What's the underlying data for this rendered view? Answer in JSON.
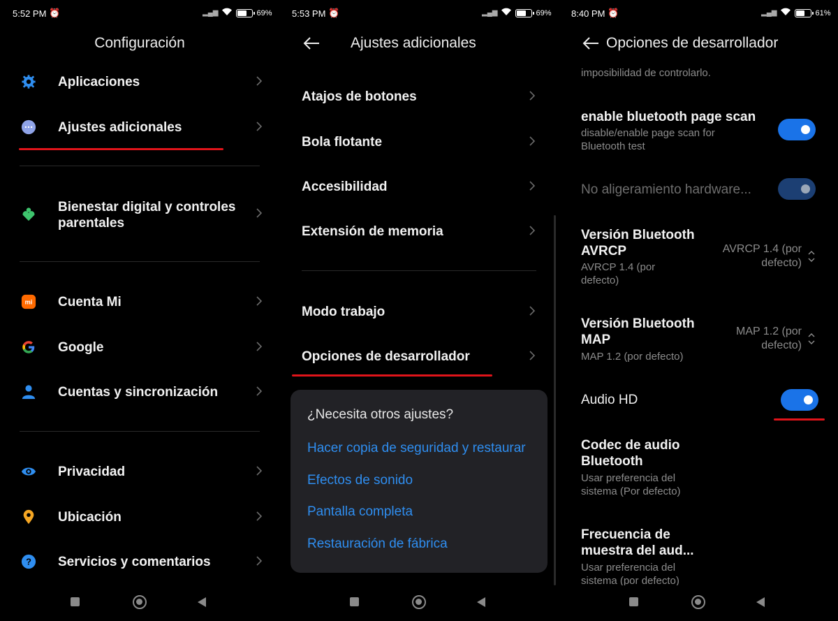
{
  "panel1": {
    "time": "5:52 PM",
    "battery": "69%",
    "battery_level": 0.69,
    "title": "Configuración",
    "items": [
      {
        "label": "Aplicaciones",
        "icon": "gear-icon"
      },
      {
        "label": "Ajustes adicionales",
        "icon": "more-dots-icon"
      },
      {
        "label": "Bienestar digital y controles parentales",
        "icon": "wellbeing-icon"
      },
      {
        "label": "Cuenta Mi",
        "icon": "mi-logo-icon"
      },
      {
        "label": "Google",
        "icon": "google-icon"
      },
      {
        "label": "Cuentas y sincronización",
        "icon": "person-icon"
      },
      {
        "label": "Privacidad",
        "icon": "eye-icon"
      },
      {
        "label": "Ubicación",
        "icon": "location-pin-icon"
      },
      {
        "label": "Servicios y comentarios",
        "icon": "help-icon"
      }
    ]
  },
  "panel2": {
    "time": "5:53 PM",
    "battery": "69%",
    "battery_level": 0.69,
    "title": "Ajustes adicionales",
    "items": [
      {
        "label": "Atajos de botones"
      },
      {
        "label": "Bola flotante"
      },
      {
        "label": "Accesibilidad"
      },
      {
        "label": "Extensión de memoria"
      },
      {
        "label": "Modo trabajo"
      },
      {
        "label": "Opciones de desarrollador"
      }
    ],
    "card": {
      "title": "¿Necesita otros ajustes?",
      "links": [
        "Hacer copia de seguridad y restaurar",
        "Efectos de sonido",
        "Pantalla completa",
        "Restauración de fábrica"
      ]
    }
  },
  "panel3": {
    "time": "8:40 PM",
    "battery": "61%",
    "battery_level": 0.61,
    "title": "Opciones de desarrollador",
    "top_text": "imposibilidad de controlarlo.",
    "bt_page_scan": {
      "label": "enable bluetooth page scan",
      "sub": "disable/enable page scan for Bluetooth test",
      "enabled": true
    },
    "hw_offload": {
      "label": "No aligeramiento hardware...",
      "enabled": true,
      "disabled_state": true
    },
    "avrcp": {
      "label": "Versión Bluetooth AVRCP",
      "sub": "AVRCP 1.4 (por defecto)",
      "value": "AVRCP 1.4 (por defecto)"
    },
    "map": {
      "label": "Versión Bluetooth MAP",
      "sub": "MAP 1.2 (por defecto)",
      "value": "MAP 1.2 (por defecto)"
    },
    "audio_hd": {
      "label": "Audio HD",
      "enabled": true
    },
    "codec": {
      "label": "Codec de audio Bluetooth",
      "sub": "Usar preferencia del sistema (Por defecto)"
    },
    "sample_rate": {
      "label": "Frecuencia de muestra del aud...",
      "sub": "Usar preferencia del sistema (por defecto)"
    }
  },
  "colors": {
    "accent": "#1a73e8",
    "link": "#2f8ef0",
    "highlight_underline": "#e0141a",
    "background": "#000000"
  }
}
